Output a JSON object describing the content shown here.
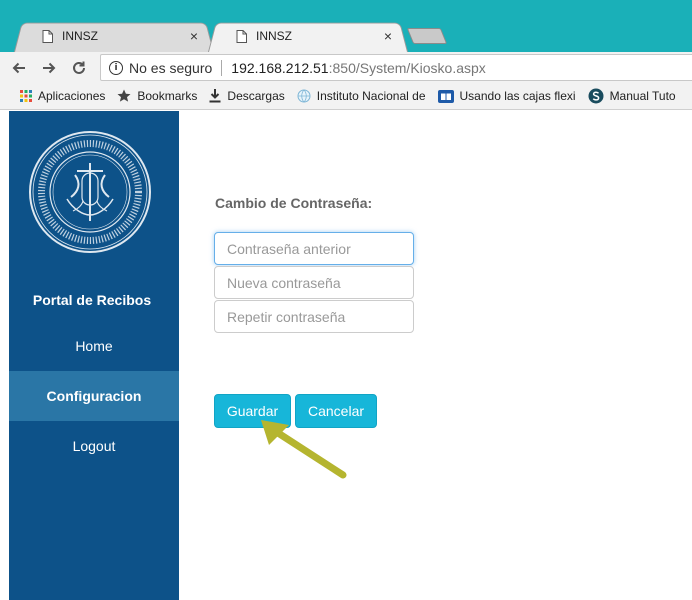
{
  "browser": {
    "tabs": [
      {
        "title": "INNSZ",
        "close": "×"
      },
      {
        "title": "INNSZ",
        "close": "×"
      }
    ],
    "address_bar": {
      "security_text": "No es seguro",
      "url_host": "192.168.212.51",
      "url_rest": ":850/System/Kiosko.aspx"
    },
    "bookmarks": [
      {
        "label": "Aplicaciones",
        "icon": "apps-grid-icon"
      },
      {
        "label": "Bookmarks",
        "icon": "star-icon"
      },
      {
        "label": "Descargas",
        "icon": "download-icon"
      },
      {
        "label": "Instituto Nacional de",
        "icon": "globe-icon"
      },
      {
        "label": "Usando las cajas flexi",
        "icon": "book-icon"
      },
      {
        "label": "Manual Tuto",
        "icon": "s-logo-icon"
      }
    ],
    "accent_color": "#1ab0b8"
  },
  "sidebar": {
    "portal_title": "Portal de Recibos",
    "nav": [
      {
        "label": "Home",
        "active": false
      },
      {
        "label": "Configuracion",
        "active": true
      },
      {
        "label": "Logout",
        "active": false
      }
    ],
    "bg_color": "#0d5289",
    "active_color": "#2a76a6"
  },
  "form": {
    "title": "Cambio de Contraseña:",
    "fields": {
      "old_password_placeholder": "Contraseña anterior",
      "new_password_placeholder": "Nueva contraseña",
      "repeat_password_placeholder": "Repetir contraseña"
    },
    "save_label": "Guardar",
    "cancel_label": "Cancelar",
    "button_color": "#17b6d9"
  },
  "annotation": {
    "icon": "arrow-pointer-icon",
    "color": "#b5b52f"
  }
}
